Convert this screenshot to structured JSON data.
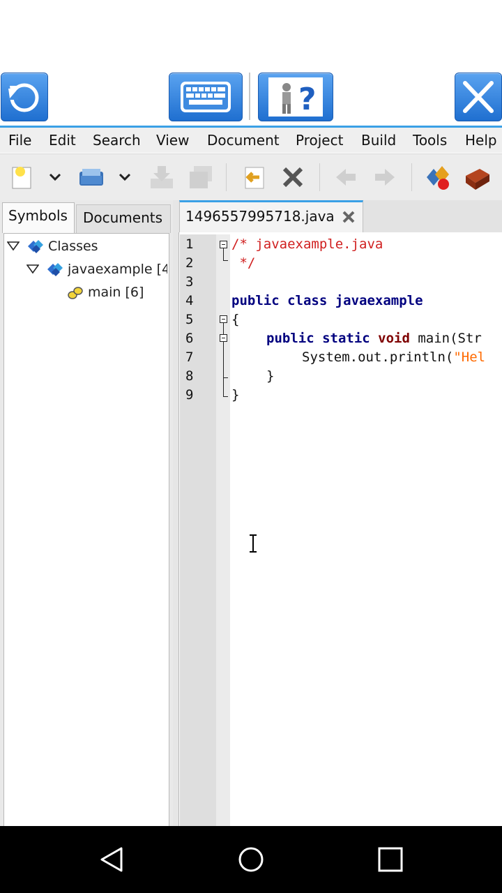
{
  "remote_toolbar": {
    "refresh": "refresh-icon",
    "keyboard": "keyboard-icon",
    "help": "help-icon",
    "close": "close-icon"
  },
  "menubar": [
    "File",
    "Edit",
    "Search",
    "View",
    "Document",
    "Project",
    "Build",
    "Tools",
    "Help"
  ],
  "toolbar_icons": [
    "new-file-icon",
    "dropdown-icon",
    "open-file-icon",
    "dropdown-icon",
    "save-icon",
    "save-all-icon",
    "revert-icon",
    "close-file-icon",
    "back-icon",
    "forward-icon",
    "compile-icon",
    "build-icon"
  ],
  "sidebar": {
    "tabs": [
      "Symbols",
      "Documents"
    ],
    "tree": {
      "root": "Classes",
      "class_node": "javaexample [4",
      "method_node": "main [6]"
    }
  },
  "editor": {
    "tab_title": "1496557995718.java",
    "line_numbers": [
      "1",
      "2",
      "3",
      "4",
      "5",
      "6",
      "7",
      "8",
      "9"
    ],
    "lines": {
      "l1": "/* javaexample.java",
      "l2": " */",
      "l4_kw": "public class",
      "l4_name": " javaexample",
      "l5": "{",
      "l6_kw": "public static",
      "l6_void": " void",
      "l6_rest": " main(Str",
      "l7_pre": "System.out.println(",
      "l7_str": "\"Hel",
      "l8": "}",
      "l9": "}"
    }
  },
  "android_nav": [
    "back-icon",
    "home-icon",
    "recents-icon"
  ]
}
